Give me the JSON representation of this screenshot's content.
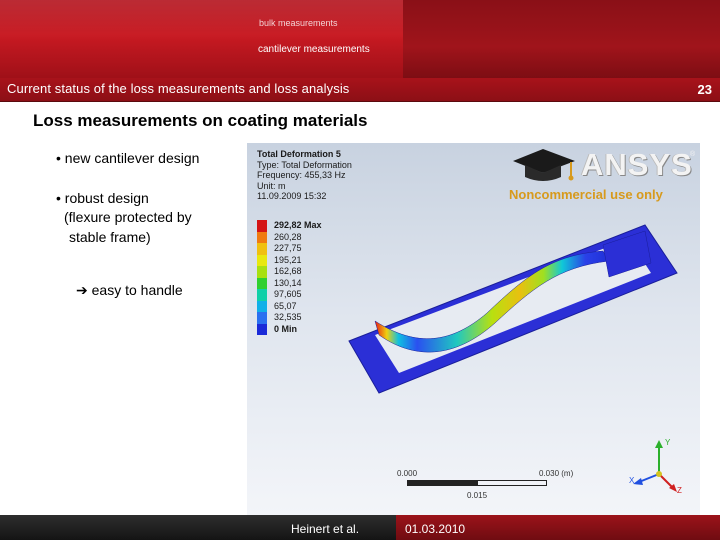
{
  "header": {
    "nav_items": [
      "bulk measurements",
      "cantilever measurements"
    ],
    "title": "Current status of the loss measurements and loss analysis",
    "slide_number": "23"
  },
  "content": {
    "heading": "Loss measurements on coating materials",
    "bullets": [
      "• new cantilever design",
      "• robust design",
      "(flexure protected by",
      "stable frame)",
      "easy to handle"
    ],
    "arrow_glyph": "➔"
  },
  "figure": {
    "info_lines": [
      "Total Deformation 5",
      "Type: Total Deformation",
      "Frequency: 455,33 Hz",
      "Unit: m",
      "11.09.2009 15:32"
    ],
    "legend": [
      {
        "label": "292,82 Max",
        "color": "#d41414"
      },
      {
        "label": "260,28",
        "color": "#f07a10"
      },
      {
        "label": "227,75",
        "color": "#f0c010"
      },
      {
        "label": "195,21",
        "color": "#e8e80e"
      },
      {
        "label": "162,68",
        "color": "#a8e010"
      },
      {
        "label": "130,14",
        "color": "#30d030"
      },
      {
        "label": "97,605",
        "color": "#10d0a8"
      },
      {
        "label": "65,07",
        "color": "#10b0e8"
      },
      {
        "label": "32,535",
        "color": "#2a70f0"
      },
      {
        "label": "0 Min",
        "color": "#1a2ad8"
      }
    ],
    "logo_text": "ANSYS",
    "logo_reg": "®",
    "logo_subtitle": "Noncommercial use only",
    "scale": {
      "left": "0.000",
      "right": "0.030 (m)",
      "mid": "0.015"
    },
    "axes": {
      "y": "Y",
      "x": "X",
      "z": "Z"
    },
    "colors": {
      "plate": "#2b2fd6",
      "background_top": "#c8d2e0"
    }
  },
  "footer": {
    "author": "Heinert et al.",
    "date": "01.03.2010"
  }
}
